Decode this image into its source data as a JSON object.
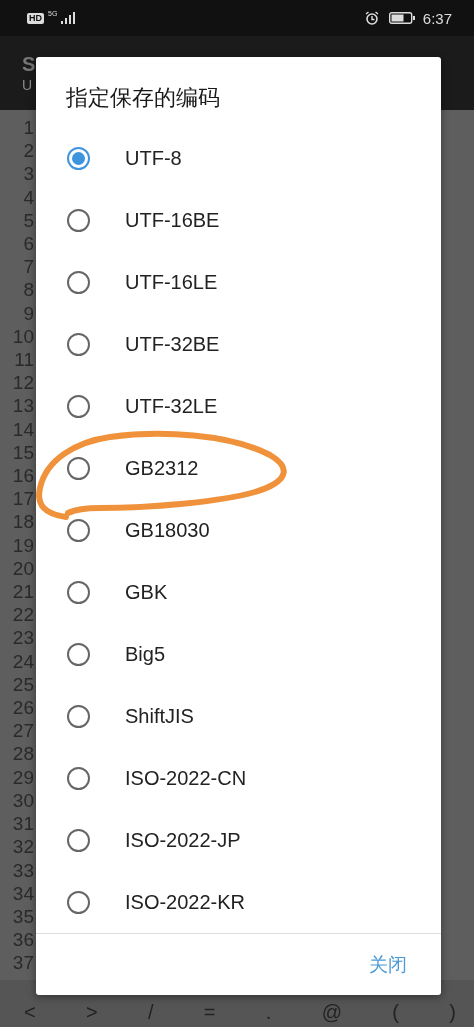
{
  "status_bar": {
    "badge": "HD",
    "network": "5G",
    "time": "6:37"
  },
  "app_bar": {
    "title": "S",
    "subtitle": "U"
  },
  "editor": {
    "line_numbers": [
      "1",
      "2",
      "3",
      "4",
      "5",
      "6",
      "7",
      "8",
      "9",
      "10",
      "11",
      "12",
      "13",
      "14",
      "15",
      "16",
      "17",
      "18",
      "19",
      "20",
      "21",
      "22",
      "23",
      "24",
      "25",
      "26",
      "27",
      "28",
      "29",
      "30",
      "31",
      "32",
      "33",
      "34",
      "35",
      "36",
      "37"
    ]
  },
  "toolbar": {
    "keys": [
      "<",
      ">",
      "/",
      "=",
      ".",
      "@",
      "(",
      ")"
    ]
  },
  "dialog": {
    "title": "指定保存的编码",
    "options": [
      {
        "label": "UTF-8",
        "selected": true
      },
      {
        "label": "UTF-16BE",
        "selected": false
      },
      {
        "label": "UTF-16LE",
        "selected": false
      },
      {
        "label": "UTF-32BE",
        "selected": false
      },
      {
        "label": "UTF-32LE",
        "selected": false
      },
      {
        "label": "GB2312",
        "selected": false
      },
      {
        "label": "GB18030",
        "selected": false
      },
      {
        "label": "GBK",
        "selected": false
      },
      {
        "label": "Big5",
        "selected": false
      },
      {
        "label": "ShiftJIS",
        "selected": false
      },
      {
        "label": "ISO-2022-CN",
        "selected": false
      },
      {
        "label": "ISO-2022-JP",
        "selected": false
      },
      {
        "label": "ISO-2022-KR",
        "selected": false
      }
    ],
    "buttons": [
      "关闭"
    ]
  }
}
